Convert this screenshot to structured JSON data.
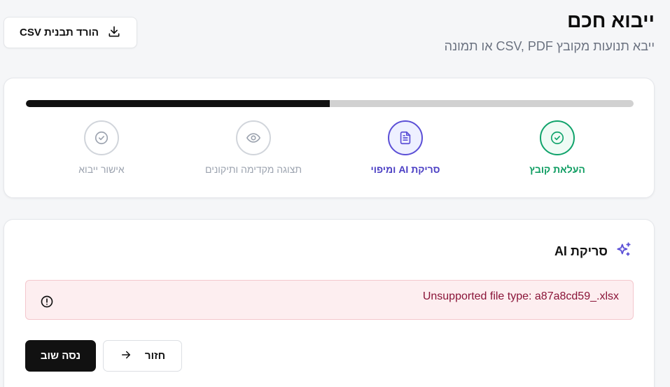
{
  "header": {
    "title": "ייבוא חכם",
    "subtitle": "ייבא תנועות מקובץ CSV, PDF או תמונה",
    "download_template_label": "הורד תבנית CSV"
  },
  "stepper": {
    "progress_percent": 50,
    "steps": [
      {
        "label": "העלאת קובץ",
        "state": "done",
        "icon": "check-circle-icon"
      },
      {
        "label": "סריקת AI ומיפוי",
        "state": "active",
        "icon": "document-icon"
      },
      {
        "label": "תצוגה מקדימה ותיקונים",
        "state": "pending",
        "icon": "eye-icon"
      },
      {
        "label": "אישור ייבוא",
        "state": "pending",
        "icon": "check-circle-icon"
      }
    ]
  },
  "scan": {
    "title": "סריקת AI",
    "icon": "sparkles-icon",
    "error_message": "Unsupported file type: a87a8cd59_.xlsx",
    "retry_label": "נסה שוב",
    "back_label": "חזור"
  },
  "colors": {
    "done": "#10a36b",
    "active": "#5b4fd6",
    "pending": "#d1d5db",
    "error_bg": "#fdeef0",
    "error_text": "#8a1438",
    "primary_button": "#111111"
  }
}
